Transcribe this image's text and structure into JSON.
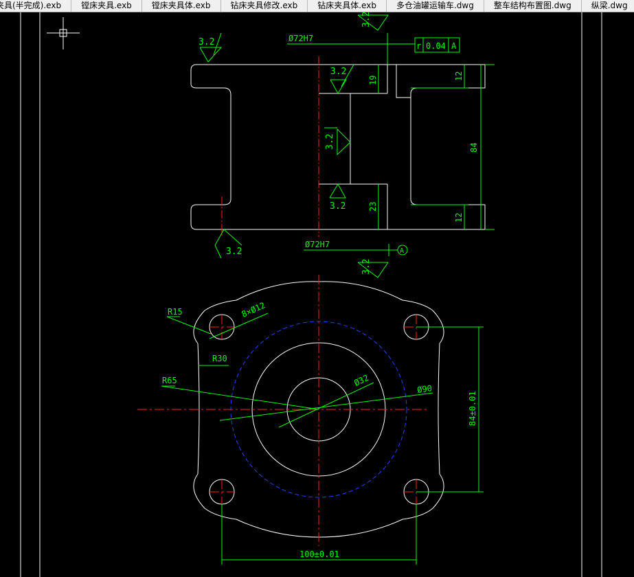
{
  "tabs": [
    {
      "label": "夹具(半完成).exb"
    },
    {
      "label": "镗床夹具.exb"
    },
    {
      "label": "镗床夹具体.exb"
    },
    {
      "label": "钻床夹具修改.exb"
    },
    {
      "label": "钻床夹具体.exb"
    },
    {
      "label": "多仓油罐运输车.dwg"
    },
    {
      "label": "整车结构布置图.dwg"
    },
    {
      "label": "纵梁.dwg"
    }
  ],
  "colors": {
    "background": "#000000",
    "geometry": "#ffffff",
    "dimension": "#00ff00",
    "centerline": "#ff0000",
    "hidden_circle": "#2040ff"
  },
  "drawing": {
    "front_view": {
      "roughness_top_left": "3.2",
      "roughness_top": "3.2",
      "roughness_bore_upper": "3.2",
      "roughness_bore_mid": "3.2",
      "roughness_bore_lower": "3.2",
      "roughness_bottom_left": "3.2",
      "roughness_bottom": "3.2",
      "dia_top": "Ø72H7",
      "dia_bottom": "Ø72H7",
      "tol_symbol": "r",
      "tol_value": "0.04",
      "tol_datum": "A",
      "datum_label": "A",
      "dim_19": "19",
      "dim_23": "23",
      "dim_12_top": "12",
      "dim_12_bottom": "12",
      "dim_84": "84"
    },
    "top_view": {
      "r15": "R15",
      "holes": "8×Ø12",
      "r30": "R30",
      "r65": "R65",
      "d32": "Ø32",
      "d90": "Ø90",
      "dim_vertical": "84±0.01",
      "dim_horizontal": "100±0.01"
    }
  }
}
